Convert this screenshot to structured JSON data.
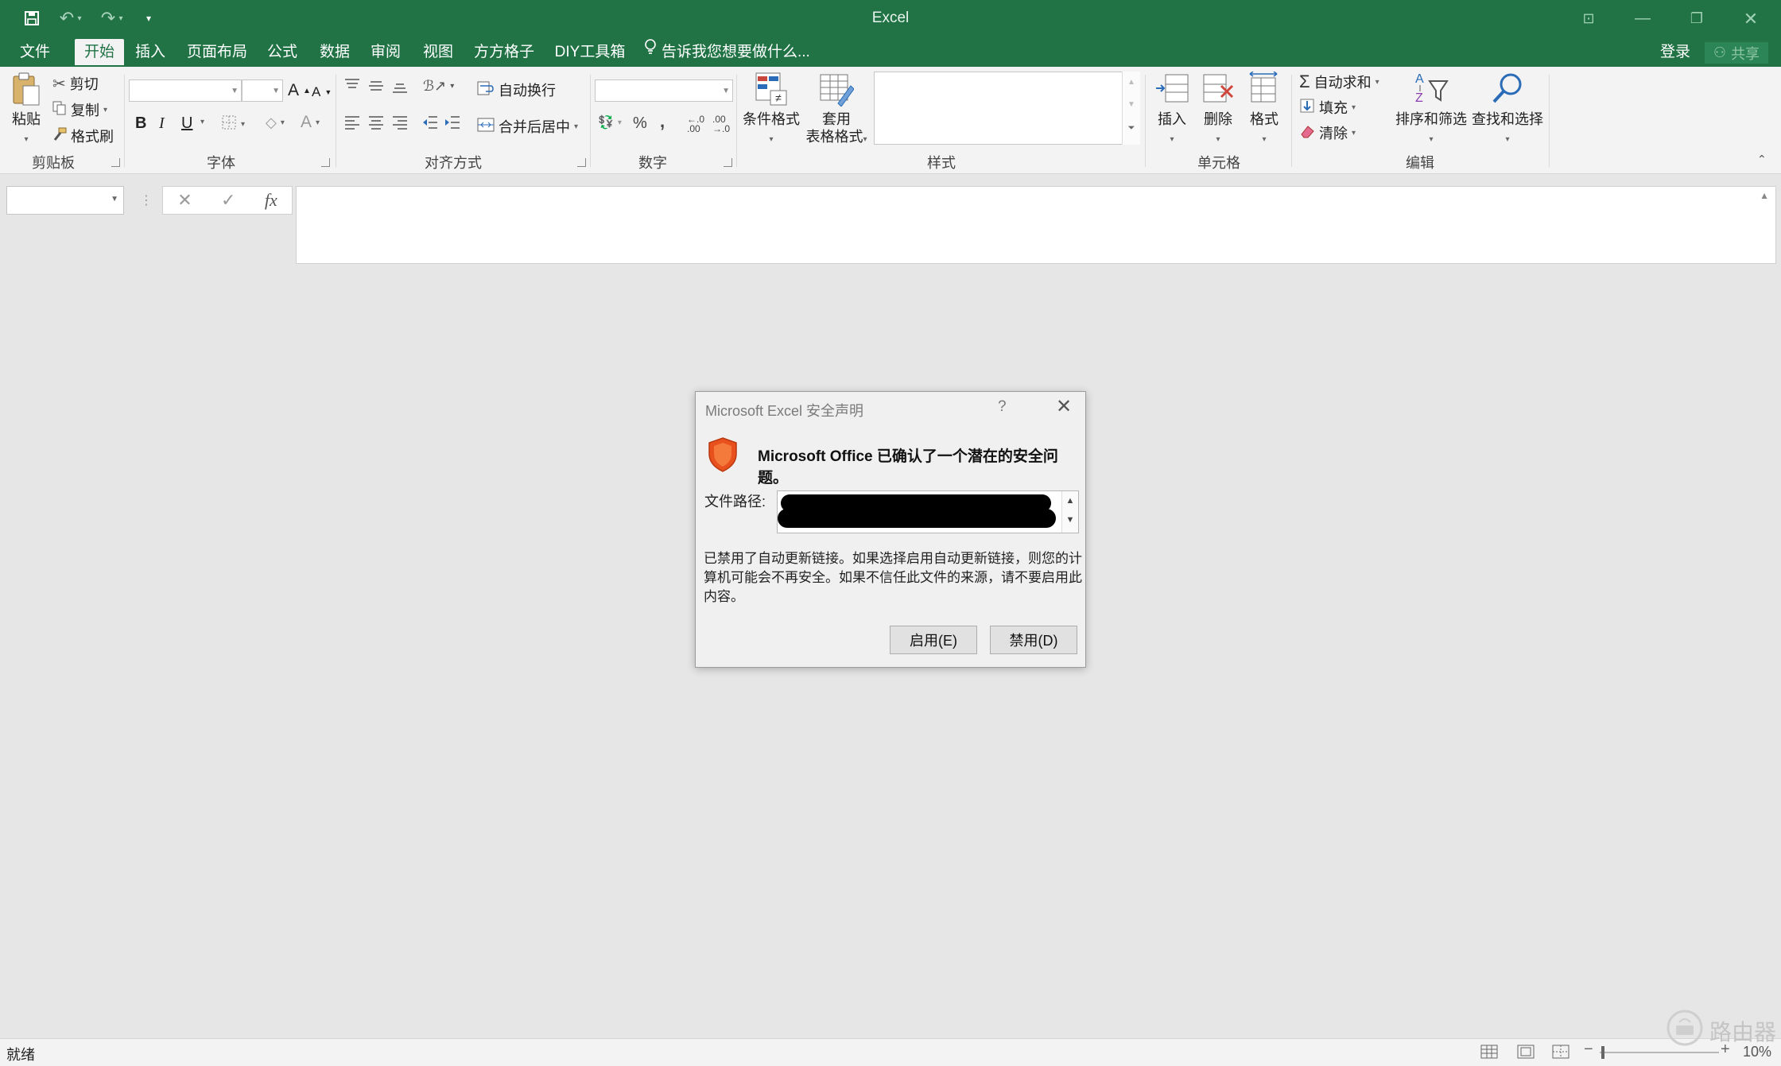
{
  "window": {
    "title": "Excel",
    "colors": {
      "accent": "#217346",
      "ribbon_bg": "#f3f3f3",
      "workspace_bg": "#e6e6e6"
    }
  },
  "quick_access": {
    "icons": [
      "save-icon",
      "undo-icon",
      "redo-icon",
      "customize-qat-icon"
    ]
  },
  "tabs": [
    {
      "label": "文件",
      "active": false
    },
    {
      "label": "开始",
      "active": true
    },
    {
      "label": "插入",
      "active": false
    },
    {
      "label": "页面布局",
      "active": false
    },
    {
      "label": "公式",
      "active": false
    },
    {
      "label": "数据",
      "active": false
    },
    {
      "label": "审阅",
      "active": false
    },
    {
      "label": "视图",
      "active": false
    },
    {
      "label": "方方格子",
      "active": false
    },
    {
      "label": "DIY工具箱",
      "active": false
    }
  ],
  "tell_me": "告诉我您想要做什么...",
  "account": {
    "login": "登录",
    "share": "共享"
  },
  "ribbon": {
    "clipboard": {
      "paste": "粘贴",
      "cut": "剪切",
      "copy": "复制",
      "format_painter": "格式刷",
      "label": "剪贴板"
    },
    "font": {
      "bold": "B",
      "italic": "I",
      "underline": "U",
      "grow": "A",
      "shrink": "A",
      "font_color": "A",
      "label": "字体"
    },
    "alignment": {
      "wrap": "自动换行",
      "merge": "合并后居中",
      "label": "对齐方式"
    },
    "number": {
      "percent": "%",
      "comma": ",",
      "inc_decimal": "←.0\n.00",
      "dec_decimal": ".00\n→.0",
      "label": "数字"
    },
    "styles": {
      "conditional": "条件格式",
      "table_line1": "套用",
      "table_line2": "表格格式",
      "label": "样式"
    },
    "cells": {
      "insert": "插入",
      "delete": "删除",
      "format": "格式",
      "label": "单元格"
    },
    "editing": {
      "autosum": "自动求和",
      "fill": "填充",
      "clear": "清除",
      "sort": "排序和筛选",
      "find": "查找和选择",
      "label": "编辑"
    }
  },
  "formula_bar": {
    "fx": "fx",
    "cancel": "✕",
    "enter": "✓"
  },
  "dialog": {
    "title": "Microsoft Excel 安全声明",
    "help": "?",
    "heading": "Microsoft Office 已确认了一个潜在的安全问题。",
    "path_label": "文件路径:",
    "path_value": "...",
    "body": "已禁用了自动更新链接。如果选择启用自动更新链接，则您的计算机可能会不再安全。如果不信任此文件的来源，请不要启用此内容。",
    "enable": "启用(E)",
    "disable": "禁用(D)"
  },
  "status": {
    "ready": "就绪",
    "zoom": "10%"
  },
  "watermark": "路由器"
}
